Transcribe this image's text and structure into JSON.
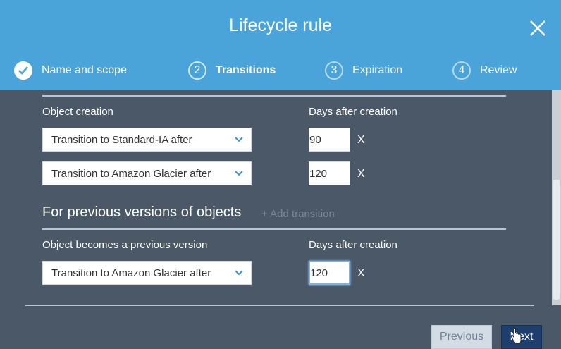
{
  "modal": {
    "title": "Lifecycle rule"
  },
  "steps": [
    {
      "number": "",
      "label": "Name and scope",
      "state": "complete"
    },
    {
      "number": "2",
      "label": "Transitions",
      "state": "active"
    },
    {
      "number": "3",
      "label": "Expiration",
      "state": "upcoming"
    },
    {
      "number": "4",
      "label": "Review",
      "state": "upcoming"
    }
  ],
  "current_versions": {
    "object_label": "Object creation",
    "days_label": "Days after creation",
    "rows": [
      {
        "transition": "Transition to Standard-IA after",
        "days": "90",
        "remove": "X"
      },
      {
        "transition": "Transition to Amazon Glacier after",
        "days": "120",
        "remove": "X"
      }
    ]
  },
  "previous_versions": {
    "heading": "For previous versions of objects",
    "add_link": "+ Add transition",
    "object_label": "Object becomes a previous version",
    "days_label": "Days after creation",
    "rows": [
      {
        "transition": "Transition to Amazon Glacier after",
        "days": "120",
        "remove": "X"
      }
    ]
  },
  "footer": {
    "previous_label": "Previous",
    "next_label": "Next"
  },
  "colors": {
    "header_bg": "#4aa3d9",
    "body_bg": "#4a5868",
    "next_button_bg": "#1e3f6e",
    "previous_button_bg": "#d3dce4"
  },
  "icons": {
    "close": "close-icon",
    "step_complete": "checkmark-icon",
    "dropdown": "chevron-down-icon"
  }
}
